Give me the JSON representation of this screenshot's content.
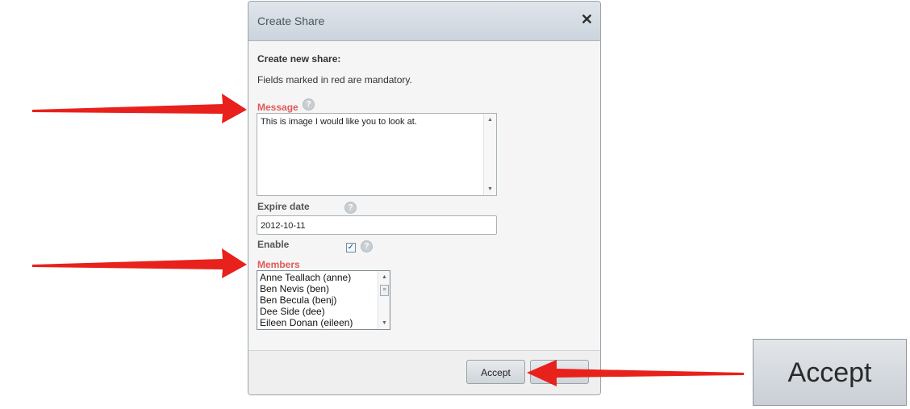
{
  "dialog": {
    "title": "Create Share",
    "close_glyph": "✕",
    "heading": "Create new share:",
    "note": "Fields marked in red are mandatory."
  },
  "fields": {
    "message": {
      "label": "Message",
      "value": "This is image I would like you to look at.",
      "required": true
    },
    "expire_date": {
      "label": "Expire date",
      "value": "2012-10-11"
    },
    "enable": {
      "label": "Enable",
      "checked": true
    },
    "members": {
      "label": "Members",
      "required": true,
      "items": [
        "Anne Teallach (anne)",
        "Ben Nevis (ben)",
        "Ben Becula (benj)",
        "Dee Side (dee)",
        "Eileen Donan (eileen)"
      ]
    },
    "help_glyph": "?"
  },
  "footer": {
    "accept_label": "Accept",
    "cancel_label": ""
  },
  "callout": {
    "zoom_label": "Accept"
  },
  "colors": {
    "required": "#e05a5a",
    "annotation_arrow": "#e8211c"
  },
  "icons": [
    "close-icon",
    "help-icon",
    "checkbox-checked-icon",
    "scroll-up-icon",
    "scroll-down-icon",
    "annotation-arrow-icon"
  ]
}
